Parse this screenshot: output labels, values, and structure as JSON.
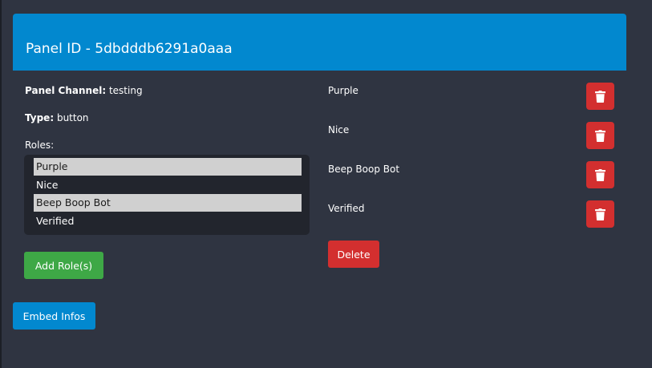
{
  "panel": {
    "title": "Panel ID - 5dbdddb6291a0aaa",
    "channel_label": "Panel Channel:",
    "channel_value": "testing",
    "type_label": "Type:",
    "type_value": "button",
    "roles_label": "Roles:"
  },
  "role_select": {
    "options": [
      {
        "label": "Purple",
        "selected": true
      },
      {
        "label": "Nice",
        "selected": false
      },
      {
        "label": "Beep Boop Bot",
        "selected": true
      },
      {
        "label": "Verified",
        "selected": false
      }
    ]
  },
  "role_list": {
    "items": [
      {
        "name": "Purple",
        "icon": "trash-icon"
      },
      {
        "name": "Nice",
        "icon": "trash-icon"
      },
      {
        "name": "Beep Boop Bot",
        "icon": "trash-icon"
      },
      {
        "name": "Verified",
        "icon": "trash-icon"
      }
    ]
  },
  "buttons": {
    "add_roles": "Add Role(s)",
    "delete": "Delete",
    "embed_infos": "Embed Infos"
  },
  "colors": {
    "background": "#2f3441",
    "header": "#0288cf",
    "select_bg": "#22252d",
    "selected_option": "#d0d0d0",
    "green": "#3ea846",
    "red": "#d32f2f"
  }
}
